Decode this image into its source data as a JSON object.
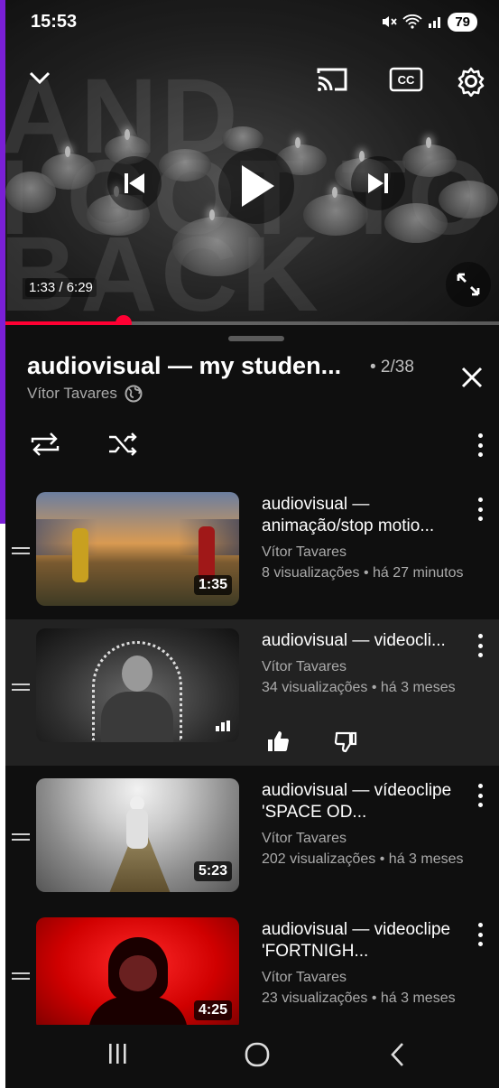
{
  "status_bar": {
    "time": "15:53",
    "battery": "79",
    "icons": [
      "mute-icon",
      "wifi-icon",
      "signal-icon",
      "battery-icon"
    ]
  },
  "player": {
    "background_text": [
      "AND",
      "I GOT TO",
      "BACK"
    ],
    "timecode": "1:33 / 6:29",
    "progress_fraction": 0.24,
    "controls": [
      "collapse-icon",
      "cast-icon",
      "captions-icon",
      "settings-icon",
      "previous-icon",
      "play-icon",
      "next-icon",
      "fullscreen-icon"
    ]
  },
  "playlist": {
    "title": "audiovisual — my studen...",
    "position": "• 2/38",
    "owner": "Vítor Tavares",
    "tools": [
      "loop-icon",
      "shuffle-icon",
      "more-icon"
    ],
    "items": [
      {
        "title": "audiovisual — animação/stop motio...",
        "channel": "Vítor Tavares",
        "stats": "8 visualizações • há 27 minutos",
        "duration": "1:35",
        "current": false
      },
      {
        "title": "audiovisual — videocli...",
        "channel": "Vítor Tavares",
        "stats": "34 visualizações • há 3 meses",
        "duration": "",
        "current": true
      },
      {
        "title": "audiovisual — vídeoclipe 'SPACE OD...",
        "channel": "Vítor Tavares",
        "stats": "202 visualizações • há 3 meses",
        "duration": "5:23",
        "current": false
      },
      {
        "title": "audiovisual — videoclipe 'FORTNIGH...",
        "channel": "Vítor Tavares",
        "stats": "23 visualizações • há 3 meses",
        "duration": "4:25",
        "current": false
      }
    ]
  },
  "navbar": [
    "recents-icon",
    "home-icon",
    "back-icon"
  ],
  "colors": {
    "accent": "#ff0033",
    "frame": "#7a1fd6",
    "background": "#0f0f0f",
    "current_row": "#222222"
  }
}
